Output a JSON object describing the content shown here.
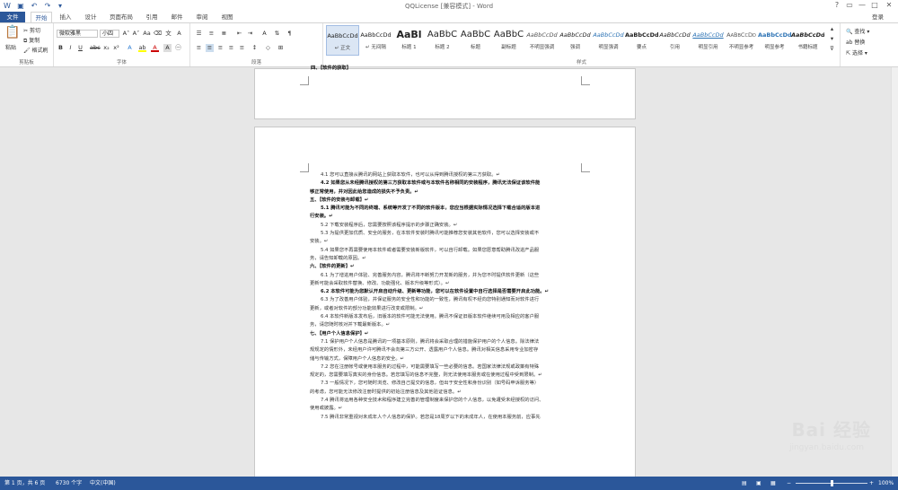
{
  "window": {
    "title": "QQLicense [兼容模式] - Word",
    "login": "登录",
    "controls": [
      "?",
      "▭",
      "—",
      "□",
      "✕"
    ]
  },
  "tabs": [
    "文件",
    "开始",
    "插入",
    "设计",
    "页面布局",
    "引用",
    "邮件",
    "审阅",
    "视图"
  ],
  "clipboard": {
    "paste": "粘贴",
    "cut": "剪切",
    "copy": "复制",
    "painter": "格式刷",
    "label": "剪贴板"
  },
  "font": {
    "name": "微软雅黑",
    "size": "小四",
    "label": "字体"
  },
  "paragraph": {
    "label": "段落"
  },
  "styles": {
    "items": [
      {
        "preview": "AaBbCcDd",
        "name": "↵ 正文"
      },
      {
        "preview": "AaBbCcDd",
        "name": "↵ 无间隔"
      },
      {
        "preview": "AaBl",
        "name": "标题 1"
      },
      {
        "preview": "AaBbC",
        "name": "标题 2"
      },
      {
        "preview": "AaBbC",
        "name": "标题"
      },
      {
        "preview": "AaBbC",
        "name": "副标题"
      },
      {
        "preview": "AaBbCcDd",
        "name": "不明显强调"
      },
      {
        "preview": "AaBbCcDd",
        "name": "强调"
      },
      {
        "preview": "AaBbCcDd",
        "name": "明显强调"
      },
      {
        "preview": "AaBbCcDd",
        "name": "要点"
      },
      {
        "preview": "AaBbCcDd",
        "name": "引用"
      },
      {
        "preview": "AaBbCcDd",
        "name": "明显引用"
      },
      {
        "preview": "AaBbCcDd",
        "name": "不明显参考"
      },
      {
        "preview": "AaBbCcDd",
        "name": "明显参考"
      },
      {
        "preview": "AaBbCcDd",
        "name": "书籍标题"
      }
    ],
    "label": "样式"
  },
  "editing": {
    "find": "查找",
    "replace": "替换",
    "select": "选择"
  },
  "page1_header": "四、【软件的获取】",
  "doc_lines": [
    {
      "t": "4.1 您可以直接从腾讯的网站上获取本软件，也可以从得到腾讯授权的第三方获取。↵",
      "s": "i"
    },
    {
      "t": "4.2 如果您从未经腾讯授权的第三方获取本软件或与本软件名称相同的安装程序，腾讯无法保证该软件能",
      "s": "ib"
    },
    {
      "t": "够正常使用，并对因此给您造成的损失不予负责。↵",
      "s": "b"
    },
    {
      "t": "五、【软件的安装与卸载】↵",
      "s": "b"
    },
    {
      "t": "5.1 腾讯可能为不同的终端、系统等开发了不同的软件版本，您应当根据实际情况选择下载合适的版本进",
      "s": "ib"
    },
    {
      "t": "行安装。↵",
      "s": "b"
    },
    {
      "t": "5.2 下载安装程序后，您需要按照该程序提示的步骤正确安装。↵",
      "s": "i"
    },
    {
      "t": "5.3 为提供更加优质、安全的服务，在本软件安装时腾讯可能推荐您安装其他软件，您可以选择安装或不",
      "s": "i"
    },
    {
      "t": "安装。↵",
      "s": ""
    },
    {
      "t": "5.4 如果您不再需要使用本软件或者需要安装新版软件，可以自行卸载。如果您愿意帮助腾讯改进产品服",
      "s": "i"
    },
    {
      "t": "务，请告知卸载的原因。↵",
      "s": ""
    },
    {
      "t": "六、【软件的更新】↵",
      "s": "b"
    },
    {
      "t": "6.1 为了增进用户体验、完善服务内容，腾讯将不断努力开发新的服务，并为您不时提供软件更新（这些",
      "s": "i"
    },
    {
      "t": "更新可能会采取软件替换、修改、功能强化、版本升级等形式）。↵",
      "s": ""
    },
    {
      "t": "6.2 本软件可能为您默认开启自动升级、更新等功能，您可以在软件设置中自行选择是否需要开启此功能。↵",
      "s": "ib"
    },
    {
      "t": "6.3 为了改善用户体验，并保证服务的安全性和功能的一致性，腾讯有权不经向您特别通知而对软件进行",
      "s": "i"
    },
    {
      "t": "更新，或者对软件的部分功能效果进行改变或限制。↵",
      "s": ""
    },
    {
      "t": "6.4 本软件新版本发布后，旧版本的软件可能无法使用。腾讯不保证旧版本软件继续可用及相应的客户服",
      "s": "i"
    },
    {
      "t": "务，请您随时核对并下载最新版本。↵",
      "s": ""
    },
    {
      "t": "七、【用户个人信息保护】↵",
      "s": "b"
    },
    {
      "t": "7.1 保护用户个人信息是腾讯的一项基本原则，腾讯将会采取合理的措施保护用户的个人信息。除法律法",
      "s": "i"
    },
    {
      "t": "规规定的情形外，未经用户许可腾讯不会向第三方公开、透露用户个人信息。腾讯对相关信息采用专业加密存",
      "s": ""
    },
    {
      "t": "储与传输方式，保障用户个人信息的安全。↵",
      "s": ""
    },
    {
      "t": "7.2 您在注册帐号或使用本服务的过程中，可能需要填写一些必要的信息。若国家法律法规或政策有特殊",
      "s": "i"
    },
    {
      "t": "规定的，您需要填写真实的身份信息。若您填写的信息不完整，则无法使用本服务或在使用过程中受到限制。↵",
      "s": ""
    },
    {
      "t": "7.3 一般情况下，您可随时浏览、修改自己提交的信息，但出于安全性和身份识别（如号码申诉服务等）",
      "s": "i"
    },
    {
      "t": "的考虑，您可能无法修改注册时提供的初始注册信息及其他验证信息。↵",
      "s": ""
    },
    {
      "t": "7.4 腾讯将运用各种安全技术和程序建立完善的管理制度来保护您的个人信息，以免遭受未经授权的访问、",
      "s": "i"
    },
    {
      "t": "使用或披露。↵",
      "s": ""
    },
    {
      "t": "7.5 腾讯非常重视对未成年人个人信息的保护。若您是18周岁以下的未成年人，在使用本服务前，应事先",
      "s": "i"
    }
  ],
  "status": {
    "page": "第 1 页，共 6 页",
    "words": "6730 个字",
    "lang": "中文(中国)",
    "zoom": "100%"
  },
  "watermark": {
    "brand": "Bai 经验",
    "url": "jingyan.baidu.com"
  }
}
